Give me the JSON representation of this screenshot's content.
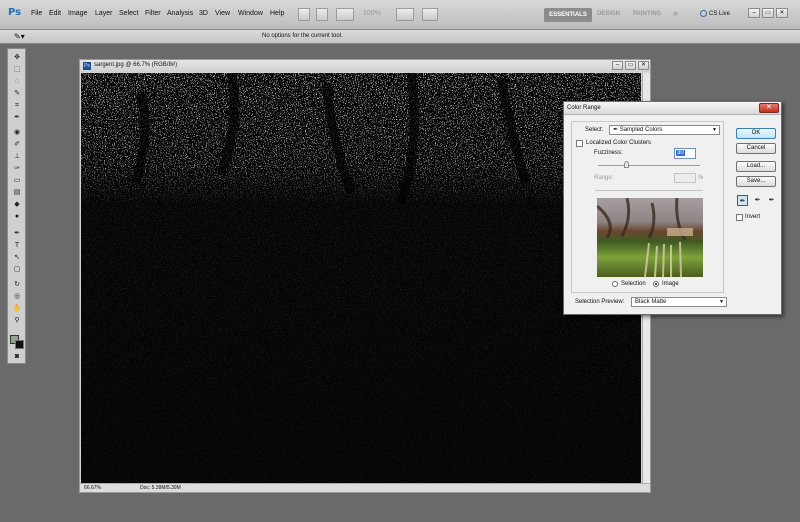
{
  "menubar": {
    "logo": "Ps",
    "items": [
      "File",
      "Edit",
      "Image",
      "Layer",
      "Select",
      "Filter",
      "Analysis",
      "3D",
      "View",
      "Window",
      "Help"
    ],
    "zoom_level": "100%",
    "workspaces": {
      "active": "ESSENTIALS",
      "others": [
        "DESIGN",
        "PAINTING"
      ],
      "more": "»"
    },
    "cs_live": "CS Live",
    "window_controls": {
      "minimize": "–",
      "restore": "▭",
      "close": "✕"
    }
  },
  "options_bar": {
    "message": "No options for the current tool."
  },
  "document": {
    "title": "sargent.jpg @ 66.7% (RGB/8#)",
    "zoom": "66.67%",
    "doc_size": "Doc: 5.39M/5.39M",
    "controls": {
      "minimize": "–",
      "restore": "▭",
      "close": "✕"
    }
  },
  "color_range": {
    "title": "Color Range",
    "close_glyph": "✕",
    "select_label": "Select:",
    "select_value": "Sampled Colors",
    "localized_clusters_label": "Localized Color Clusters",
    "localized_clusters_checked": false,
    "fuzziness_label": "Fuzziness:",
    "fuzziness_value": "30",
    "range_label": "Range:",
    "range_unit": "%",
    "selection_radio_label": "Selection",
    "image_radio_label": "Image",
    "view_mode": "Image",
    "selection_preview_label": "Selection Preview:",
    "selection_preview_value": "Black Matte",
    "buttons": {
      "ok": "OK",
      "cancel": "Cancel",
      "load": "Load...",
      "save": "Save..."
    },
    "invert_label": "Invert",
    "invert_checked": false
  }
}
